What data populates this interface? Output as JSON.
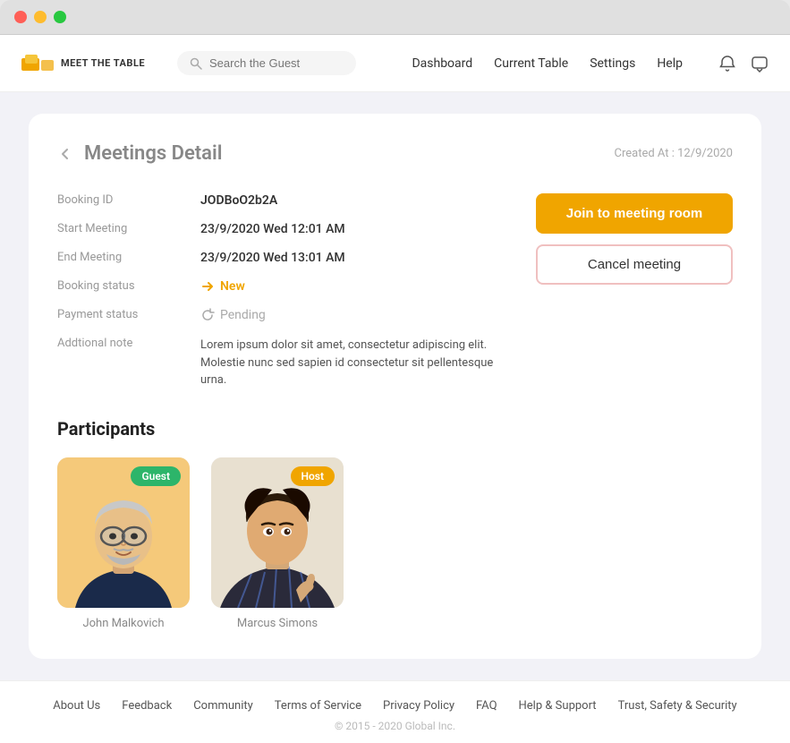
{
  "window": {
    "chrome": {
      "red": "red",
      "yellow": "yellow",
      "green": "green"
    }
  },
  "navbar": {
    "logo_text": "MEET THE TABLE",
    "search_placeholder": "Search the Guest",
    "links": [
      {
        "label": "Dashboard",
        "key": "dashboard"
      },
      {
        "label": "Current Table",
        "key": "current-table"
      },
      {
        "label": "Settings",
        "key": "settings"
      },
      {
        "label": "Help",
        "key": "help"
      }
    ]
  },
  "page": {
    "back_label": "‹",
    "title": "Meetings Detail",
    "created_at": "Created At : 12/9/2020",
    "booking_id_label": "Booking ID",
    "booking_id": "JODBoO2b2A",
    "start_meeting_label": "Start Meeting",
    "start_meeting": "23/9/2020 Wed 12:01 AM",
    "end_meeting_label": "End Meeting",
    "end_meeting": "23/9/2020 Wed 13:01 AM",
    "booking_status_label": "Booking status",
    "booking_status": "New",
    "payment_status_label": "Payment status",
    "payment_status": "Pending",
    "additional_note_label": "Addtional note",
    "additional_note": "Lorem ipsum dolor sit amet, consectetur adipiscing elit. Molestie nunc sed sapien id consectetur sit pellentesque urna.",
    "join_btn": "Join to meeting room",
    "cancel_btn": "Cancel meeting",
    "participants_title": "Participants",
    "participants": [
      {
        "name": "John Malkovich",
        "role": "Guest",
        "badge_class": "badge-guest"
      },
      {
        "name": "Marcus Simons",
        "role": "Host",
        "badge_class": "badge-host"
      }
    ]
  },
  "footer": {
    "links": [
      {
        "label": "About Us"
      },
      {
        "label": "Feedback"
      },
      {
        "label": "Community"
      },
      {
        "label": "Terms of Service"
      },
      {
        "label": "Privacy Policy"
      },
      {
        "label": "FAQ"
      },
      {
        "label": "Help & Support"
      },
      {
        "label": "Trust, Safety & Security"
      }
    ],
    "copyright": "© 2015 - 2020 Global Inc."
  }
}
